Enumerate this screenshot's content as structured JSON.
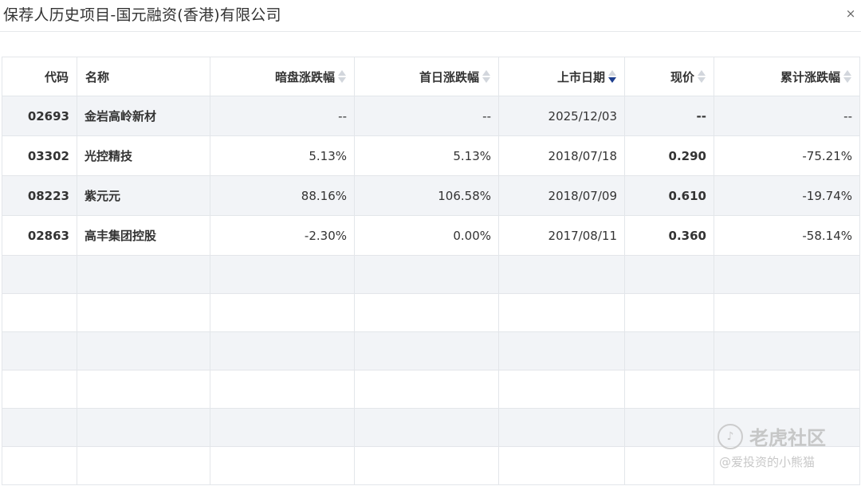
{
  "dialog": {
    "title": "保荐人历史项目-国元融资(香港)有限公司",
    "close_glyph": "×"
  },
  "table": {
    "headers": {
      "code": "代码",
      "name": "名称",
      "grey_market_change": "暗盘涨跌幅",
      "first_day_change": "首日涨跌幅",
      "listing_date": "上市日期",
      "current_price": "现价",
      "cumulative_change": "累计涨跌幅"
    },
    "sorted_by": "listing_date",
    "sort_direction": "descending",
    "rows": [
      {
        "code": "02693",
        "name": "金岩高岭新材",
        "grey_market_change": "--",
        "first_day_change": "--",
        "listing_date": "2025/12/03",
        "current_price": "--",
        "cumulative_change": "--"
      },
      {
        "code": "03302",
        "name": "光控精技",
        "grey_market_change": "5.13%",
        "first_day_change": "5.13%",
        "listing_date": "2018/07/18",
        "current_price": "0.290",
        "cumulative_change": "-75.21%"
      },
      {
        "code": "08223",
        "name": "紫元元",
        "grey_market_change": "88.16%",
        "first_day_change": "106.58%",
        "listing_date": "2018/07/09",
        "current_price": "0.610",
        "cumulative_change": "-19.74%"
      },
      {
        "code": "02863",
        "name": "高丰集团控股",
        "grey_market_change": "-2.30%",
        "first_day_change": "0.00%",
        "listing_date": "2017/08/11",
        "current_price": "0.360",
        "cumulative_change": "-58.14%"
      }
    ]
  },
  "watermark": {
    "brand": "老虎社区",
    "handle": "@爱投资的小熊猫",
    "logo_icon": "tiger-logo-icon"
  },
  "colors": {
    "link_blue": "#1e3f8e",
    "up_red": "#e04b4b",
    "down_green": "#2ab14a",
    "row_alt": "#f2f4f7"
  }
}
